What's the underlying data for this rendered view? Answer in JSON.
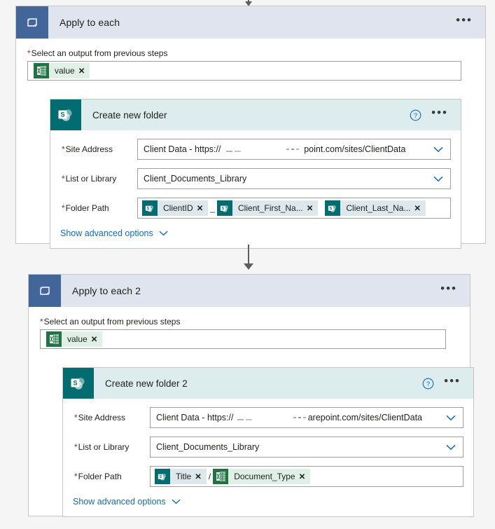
{
  "flow": {
    "scope1": {
      "icon": "loop-icon",
      "title": "Apply to each",
      "more_label": "•••",
      "output_label": "Select an output from previous steps",
      "output_token": {
        "label": "value",
        "icon": "excel-icon",
        "remove": "✕"
      },
      "action": {
        "icon": "sharepoint-icon",
        "title": "Create new folder",
        "help_label": "?",
        "more_label": "•••",
        "fields": [
          {
            "label": "Site Address",
            "value": "Client Data - https://",
            "value_tail": "point.com/sites/ClientData",
            "control": "dropdown"
          },
          {
            "label": "List or Library",
            "value": "Client_Documents_Library",
            "control": "dropdown"
          }
        ],
        "folder_path_label": "Folder Path",
        "folder_path_tokens": [
          {
            "label": "ClientID",
            "icon": "sharepoint-icon",
            "type": "sp",
            "remove": "✕"
          },
          {
            "separator": "_"
          },
          {
            "label": "Client_First_Na...",
            "icon": "sharepoint-icon",
            "type": "sp",
            "remove": "✕"
          },
          {
            "separator": ""
          },
          {
            "label": "Client_Last_Na...",
            "icon": "sharepoint-icon",
            "type": "sp",
            "remove": "✕"
          }
        ],
        "advanced_label": "Show advanced options"
      }
    },
    "scope2": {
      "icon": "loop-icon",
      "title": "Apply to each 2",
      "more_label": "•••",
      "output_label": "Select an output from previous steps",
      "output_token": {
        "label": "value",
        "icon": "excel-icon",
        "remove": "✕"
      },
      "action": {
        "icon": "sharepoint-icon",
        "title": "Create new folder 2",
        "help_label": "?",
        "more_label": "•••",
        "fields": [
          {
            "label": "Site Address",
            "value": "Client Data - https://",
            "value_tail": "arepoint.com/sites/ClientData",
            "control": "dropdown"
          },
          {
            "label": "List or Library",
            "value": "Client_Documents_Library",
            "control": "dropdown"
          }
        ],
        "folder_path_label": "Folder Path",
        "folder_path_tokens": [
          {
            "label": "Title",
            "icon": "sharepoint-icon",
            "type": "sp",
            "remove": "✕"
          },
          {
            "separator": "/"
          },
          {
            "label": "Document_Type",
            "icon": "excel-icon",
            "type": "excel",
            "remove": "✕"
          }
        ],
        "advanced_label": "Show advanced options"
      }
    }
  },
  "colors": {
    "loop_header_bg": "#e0e4ee",
    "loop_icon_bg": "#42659a",
    "sharepoint_teal": "#036c70",
    "sharepoint_header_bg": "#ddeded",
    "excel_green": "#217346",
    "link_blue": "#0f6cbd",
    "required_red": "#a4262c",
    "canvas_bg": "#f5f5f5"
  }
}
